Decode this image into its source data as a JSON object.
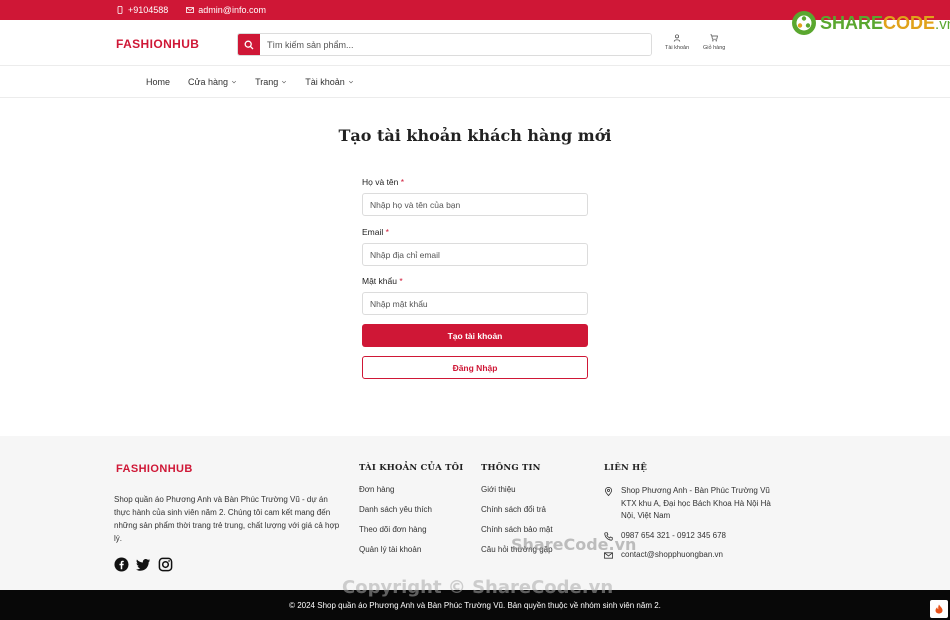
{
  "topbar": {
    "phone": "+9104588",
    "email": "admin@info.com"
  },
  "header": {
    "logo": "FASHIONHUB",
    "search_placeholder": "Tìm kiếm sản phẩm...",
    "account_label": "Tài khoản",
    "cart_label": "Giỏ hàng"
  },
  "nav": {
    "items": [
      "Home",
      "Cửa hàng",
      "Trang",
      "Tài khoản"
    ]
  },
  "main": {
    "title": "Tạo tài khoản khách hàng mới",
    "name_label": "Họ và tên",
    "name_placeholder": "Nhập họ và tên của bạn",
    "email_label": "Email",
    "email_placeholder": "Nhập địa chỉ email",
    "password_label": "Mật khẩu",
    "password_placeholder": "Nhập mật khẩu",
    "required_mark": "*",
    "submit_label": "Tạo tài khoản",
    "login_label": "Đăng Nhập"
  },
  "footer": {
    "logo": "FASHIONHUB",
    "about": "Shop quần áo Phương Anh và Bàn Phúc Trường Vũ - dự án thực hành của sinh viên năm 2. Chúng tôi cam kết mang đến những sản phẩm thời trang trẻ trung, chất lượng với giá cả hợp lý.",
    "col_account": {
      "title": "TÀI KHOẢN CỦA TÔI",
      "links": [
        "Đơn hàng",
        "Danh sách yêu thích",
        "Theo dõi đơn hàng",
        "Quản lý tài khoản"
      ]
    },
    "col_info": {
      "title": "THÔNG TIN",
      "links": [
        "Giới thiệu",
        "Chính sách đổi trả",
        "Chính sách bảo mật",
        "Câu hỏi thường gặp"
      ]
    },
    "col_contact": {
      "title": "LIÊN HỆ",
      "address": "Shop Phương Anh - Bàn Phúc Trường Vũ KTX khu A, Đại học Bách Khoa Hà Nội Hà Nội, Việt Nam",
      "phone": "0987 654 321 - 0912 345 678",
      "email": "contact@shopphuongban.vn"
    },
    "copyright": "© 2024 Shop quần áo Phương Anh và Bàn Phúc Trường Vũ. Bản quyền thuộc về nhóm sinh viên năm 2."
  },
  "watermark": {
    "logo_share": "SHARE",
    "logo_code": "CODE",
    "logo_domain": ".vn",
    "center": "ShareCode.vn",
    "bottom": "Copyright © ShareCode.vn"
  },
  "colors": {
    "brand": "#cf1736",
    "footer_bg": "#f6f6f6",
    "bottombar_bg": "#080808"
  },
  "icons": [
    "phone-icon",
    "mail-icon",
    "search-icon",
    "user-icon",
    "cart-icon",
    "chevron-down-icon",
    "facebook-icon",
    "twitter-icon",
    "instagram-icon",
    "map-pin-icon",
    "phone-icon",
    "mail-icon"
  ]
}
